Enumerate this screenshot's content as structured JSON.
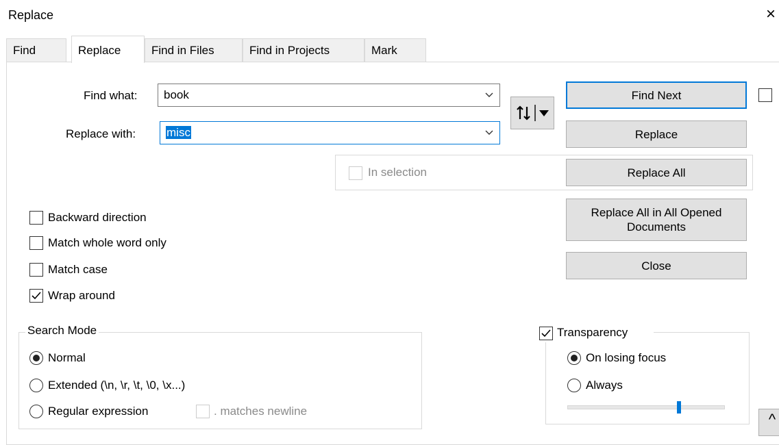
{
  "window": {
    "title": "Replace",
    "close": "×"
  },
  "tabs": [
    {
      "label": "Find"
    },
    {
      "label": "Replace"
    },
    {
      "label": "Find in Files"
    },
    {
      "label": "Find in Projects"
    },
    {
      "label": "Mark"
    }
  ],
  "find": {
    "label": "Find what:",
    "value": "book"
  },
  "replace": {
    "label": "Replace with:",
    "value": "misc"
  },
  "buttons": {
    "find_next": "Find Next",
    "replace": "Replace",
    "replace_all": "Replace All",
    "replace_all_opened_line1": "Replace All in All Opened",
    "replace_all_opened_line2": "Documents",
    "close": "Close"
  },
  "in_selection": {
    "label": "In selection",
    "checked": false,
    "enabled": false
  },
  "options": [
    {
      "label": "Backward direction",
      "checked": false
    },
    {
      "label": "Match whole word only",
      "checked": false
    },
    {
      "label": "Match case",
      "checked": false
    },
    {
      "label": "Wrap around",
      "checked": true
    }
  ],
  "search_mode": {
    "title": "Search Mode",
    "modes": [
      {
        "label": "Normal",
        "selected": true
      },
      {
        "label": "Extended (\\n, \\r, \\t, \\0, \\x...)",
        "selected": false
      },
      {
        "label": "Regular expression",
        "selected": false
      }
    ],
    "matches_newline": ". matches newline"
  },
  "transparency": {
    "label": "Transparency",
    "checked": true,
    "modes": [
      {
        "label": "On losing focus",
        "selected": true
      },
      {
        "label": "Always",
        "selected": false
      }
    ],
    "slider_level": 0.71
  },
  "collapse_glyph": "^"
}
